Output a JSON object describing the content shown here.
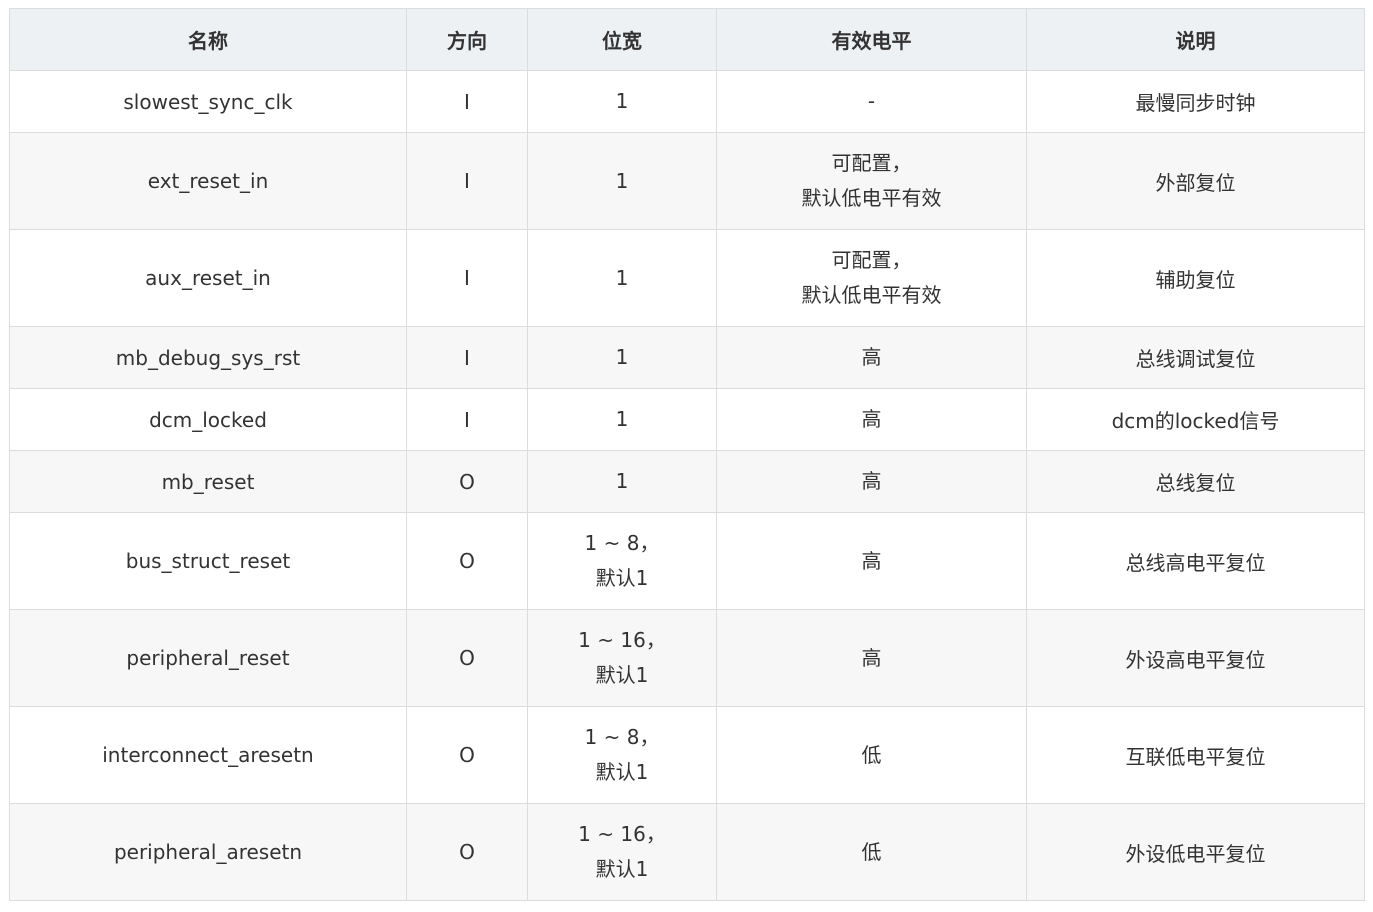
{
  "table": {
    "headers": [
      "名称",
      "方向",
      "位宽",
      "有效电平",
      "说明"
    ],
    "rows": [
      {
        "name": "slowest_sync_clk",
        "dir": "I",
        "width": [
          "1"
        ],
        "level": [
          "-"
        ],
        "desc": "最慢同步时钟"
      },
      {
        "name": "ext_reset_in",
        "dir": "I",
        "width": [
          "1"
        ],
        "level": [
          "可配置，",
          "默认低电平有效"
        ],
        "desc": "外部复位"
      },
      {
        "name": "aux_reset_in",
        "dir": "I",
        "width": [
          "1"
        ],
        "level": [
          "可配置，",
          "默认低电平有效"
        ],
        "desc": "辅助复位"
      },
      {
        "name": "mb_debug_sys_rst",
        "dir": "I",
        "width": [
          "1"
        ],
        "level": [
          "高"
        ],
        "desc": "总线调试复位"
      },
      {
        "name": "dcm_locked",
        "dir": "I",
        "width": [
          "1"
        ],
        "level": [
          "高"
        ],
        "desc": "dcm的locked信号"
      },
      {
        "name": "mb_reset",
        "dir": "O",
        "width": [
          "1"
        ],
        "level": [
          "高"
        ],
        "desc": "总线复位"
      },
      {
        "name": "bus_struct_reset",
        "dir": "O",
        "width": [
          "1 ~ 8，",
          "默认1"
        ],
        "level": [
          "高"
        ],
        "desc": "总线高电平复位"
      },
      {
        "name": "peripheral_reset",
        "dir": "O",
        "width": [
          "1 ~ 16，",
          "默认1"
        ],
        "level": [
          "高"
        ],
        "desc": "外设高电平复位"
      },
      {
        "name": "interconnect_aresetn",
        "dir": "O",
        "width": [
          "1 ~ 8，",
          "默认1"
        ],
        "level": [
          "低"
        ],
        "desc": "互联低电平复位"
      },
      {
        "name": "peripheral_aresetn",
        "dir": "O",
        "width": [
          "1 ~ 16，",
          "默认1"
        ],
        "level": [
          "低"
        ],
        "desc": "外设低电平复位"
      }
    ]
  }
}
